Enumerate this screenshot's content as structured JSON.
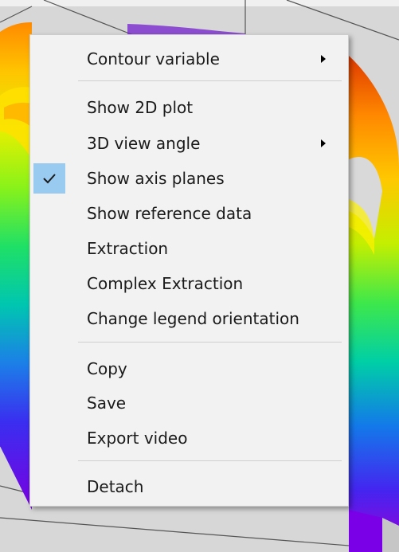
{
  "menu": {
    "items": [
      {
        "label": "Contour variable",
        "has_submenu": true
      },
      {
        "label": "Show 2D plot",
        "has_submenu": false
      },
      {
        "label": "3D view angle",
        "has_submenu": true
      },
      {
        "label": "Show axis planes",
        "has_submenu": false,
        "checked": true
      },
      {
        "label": "Show reference data",
        "has_submenu": false
      },
      {
        "label": "Extraction",
        "has_submenu": false
      },
      {
        "label": "Complex Extraction",
        "has_submenu": false
      },
      {
        "label": "Change legend orientation",
        "has_submenu": false
      },
      {
        "label": "Copy",
        "has_submenu": false
      },
      {
        "label": "Save",
        "has_submenu": false
      },
      {
        "label": "Export video",
        "has_submenu": false
      },
      {
        "label": "Detach",
        "has_submenu": false
      }
    ]
  },
  "colors": {
    "menu_background": "#f2f2f2",
    "check_highlight": "#99cbf1",
    "plot_floor": "#d9d9d9",
    "contour_gradient": [
      "#cc0000",
      "#ff6600",
      "#ffcc00",
      "#99ff00",
      "#00ff66",
      "#00cccc",
      "#0066ff",
      "#6600ff",
      "#cc00cc"
    ]
  },
  "icons": [
    "submenu-arrow-icon",
    "checkmark-icon"
  ]
}
